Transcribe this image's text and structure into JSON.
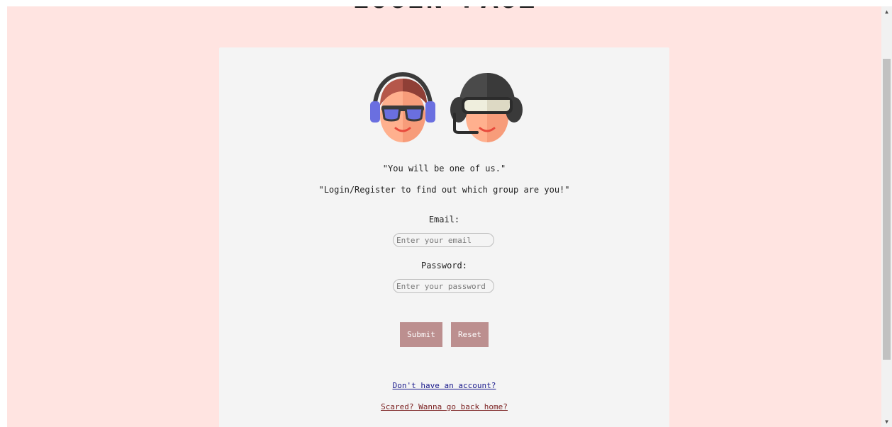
{
  "page": {
    "title": "LOGIN PAGE"
  },
  "intro": {
    "quote_one": "\"You will be one of us.\"",
    "quote_two": "\"Login/Register to find out which group are you!\""
  },
  "form": {
    "email_label": "Email:",
    "email_placeholder": "Enter your email",
    "email_value": "",
    "password_label": "Password:",
    "password_placeholder": "Enter your password",
    "password_value": "",
    "submit_label": "Submit",
    "reset_label": "Reset"
  },
  "links": {
    "register": "Don't have an account?",
    "home": "Scared? Wanna go back home?"
  },
  "colors": {
    "page_background": "#ffe4e1",
    "card_background": "#f4f4f4",
    "button": "#bc8f8f",
    "register_link": "#1a1a8c",
    "home_link": "#7a1f1f"
  },
  "icons": {
    "avatar_left": "headphones-avatar-icon",
    "avatar_right": "helmet-headset-avatar-icon"
  }
}
